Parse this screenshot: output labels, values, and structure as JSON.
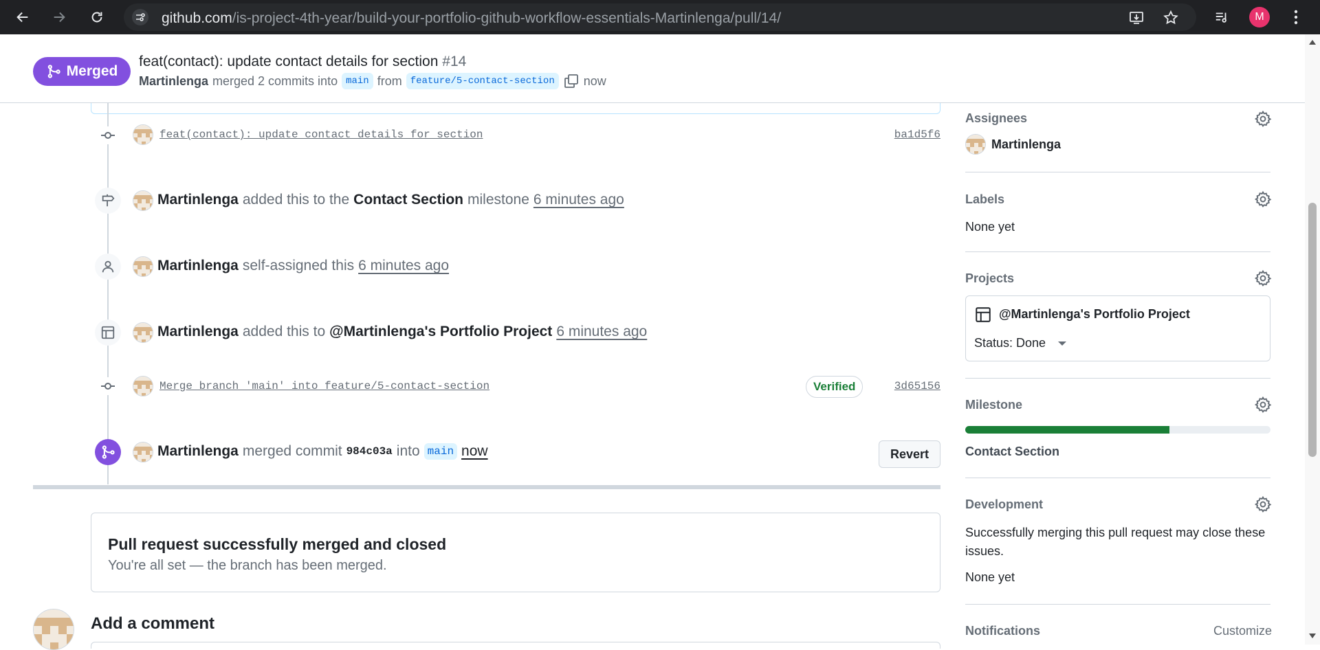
{
  "browser": {
    "url_domain": "github.com",
    "url_path": "/is-project-4th-year/build-your-portfolio-github-workflow-essentials-Martinlenga/pull/14/",
    "profile_initial": "M"
  },
  "header": {
    "state_label": "Merged",
    "title": "feat(contact): update contact details for section",
    "number": "#14",
    "author": "Martinlenga",
    "merged_text": "merged 2 commits into",
    "base_branch": "main",
    "from_text": "from",
    "head_branch": "feature/5-contact-section",
    "time": "now"
  },
  "timeline": {
    "commit1": {
      "message": "feat(contact): update contact details for section",
      "sha": "ba1d5f6"
    },
    "milestone_event": {
      "author": "Martinlenga",
      "text1": "added this to the",
      "milestone": "Contact Section",
      "text2": "milestone",
      "time": "6 minutes ago"
    },
    "assign_event": {
      "author": "Martinlenga",
      "text": "self-assigned this",
      "time": "6 minutes ago"
    },
    "project_event": {
      "author": "Martinlenga",
      "text": "added this to",
      "project": "@Martinlenga's Portfolio Project",
      "time": "6 minutes ago"
    },
    "commit2": {
      "message": "Merge branch 'main' into feature/5-contact-section",
      "badge": "Verified",
      "sha": "3d65156"
    },
    "merge_event": {
      "author": "Martinlenga",
      "text1": "merged commit",
      "sha": "984c03a",
      "text2": "into",
      "branch": "main",
      "time": "now",
      "revert_label": "Revert"
    }
  },
  "merged_box": {
    "heading": "Pull request successfully merged and closed",
    "subtext": "You're all set — the branch has been merged."
  },
  "comment": {
    "heading": "Add a comment"
  },
  "sidebar": {
    "assignees": {
      "title": "Assignees",
      "name": "Martinlenga"
    },
    "labels": {
      "title": "Labels",
      "value": "None yet"
    },
    "projects": {
      "title": "Projects",
      "project_name": "@Martinlenga's Portfolio Project",
      "status": "Status: Done"
    },
    "milestone": {
      "title": "Milestone",
      "name": "Contact Section",
      "progress_fraction": 0.67
    },
    "development": {
      "title": "Development",
      "description": "Successfully merging this pull request may close these issues.",
      "value": "None yet"
    },
    "notifications": {
      "title": "Notifications",
      "action": "Customize"
    }
  },
  "colors": {
    "merged_purple": "#8250df",
    "progress_green": "#1a7f37",
    "verified_green": "#1a7f37",
    "link_blue": "#0969da"
  }
}
